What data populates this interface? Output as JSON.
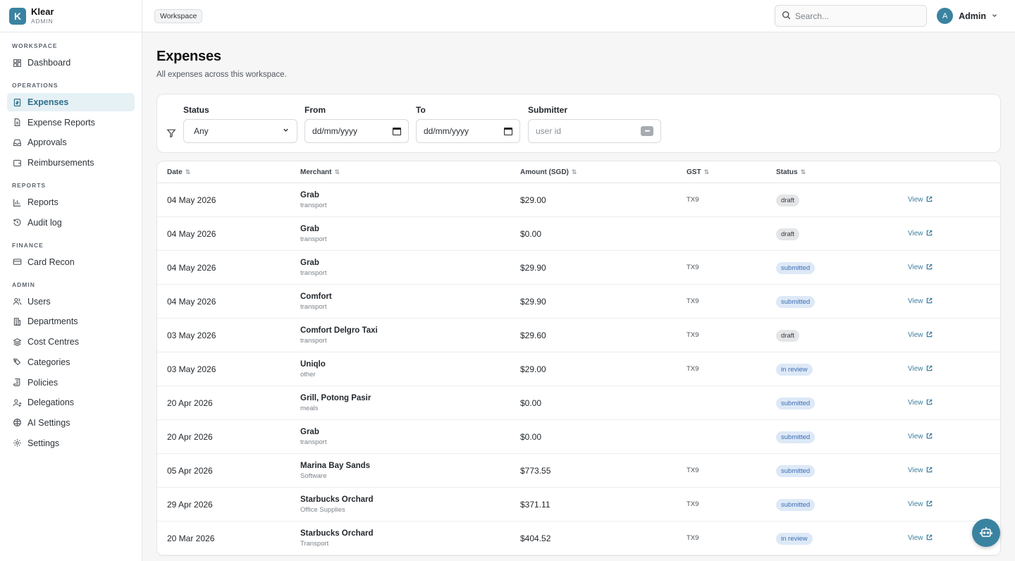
{
  "brand": {
    "initial": "K",
    "name": "Klear",
    "sub": "ADMIN"
  },
  "topbar": {
    "chip": "Workspace",
    "search_placeholder": "Search...",
    "user_initial": "A",
    "user_name": "Admin"
  },
  "sidebar": {
    "sections": [
      {
        "title": "WORKSPACE",
        "items": [
          {
            "label": "Dashboard",
            "icon": "dashboard-icon",
            "active": false
          }
        ]
      },
      {
        "title": "OPERATIONS",
        "items": [
          {
            "label": "Expenses",
            "icon": "expenses-icon",
            "active": true
          },
          {
            "label": "Expense Reports",
            "icon": "document-icon",
            "active": false
          },
          {
            "label": "Approvals",
            "icon": "inbox-icon",
            "active": false
          },
          {
            "label": "Reimbursements",
            "icon": "wallet-icon",
            "active": false
          }
        ]
      },
      {
        "title": "REPORTS",
        "items": [
          {
            "label": "Reports",
            "icon": "bar-chart-icon",
            "active": false
          },
          {
            "label": "Audit log",
            "icon": "history-icon",
            "active": false
          }
        ]
      },
      {
        "title": "FINANCE",
        "items": [
          {
            "label": "Card Recon",
            "icon": "credit-card-icon",
            "active": false
          }
        ]
      },
      {
        "title": "ADMIN",
        "items": [
          {
            "label": "Users",
            "icon": "users-icon",
            "active": false
          },
          {
            "label": "Departments",
            "icon": "building-icon",
            "active": false
          },
          {
            "label": "Cost Centres",
            "icon": "layers-icon",
            "active": false
          },
          {
            "label": "Categories",
            "icon": "tags-icon",
            "active": false
          },
          {
            "label": "Policies",
            "icon": "scroll-icon",
            "active": false
          },
          {
            "label": "Delegations",
            "icon": "user-switch-icon",
            "active": false
          },
          {
            "label": "AI Settings",
            "icon": "brain-icon",
            "active": false
          },
          {
            "label": "Settings",
            "icon": "gear-icon",
            "active": false
          }
        ]
      }
    ]
  },
  "page": {
    "title": "Expenses",
    "subtitle": "All expenses across this workspace."
  },
  "filters": {
    "status_label": "Status",
    "status_value": "Any",
    "from_label": "From",
    "from_value": "dd/mm/yyyy",
    "to_label": "To",
    "to_value": "dd/mm/yyyy",
    "submitter_label": "Submitter",
    "submitter_placeholder": "user id"
  },
  "table": {
    "headers": {
      "date": "Date",
      "merchant": "Merchant",
      "amount": "Amount (SGD)",
      "gst": "GST",
      "status": "Status"
    },
    "view_label": "View",
    "rows": [
      {
        "date": "04 May 2026",
        "merchant": "Grab",
        "category": "transport",
        "amount": "$29.00",
        "gst": "TX9",
        "status": "draft"
      },
      {
        "date": "04 May 2026",
        "merchant": "Grab",
        "category": "transport",
        "amount": "$0.00",
        "gst": "",
        "status": "draft"
      },
      {
        "date": "04 May 2026",
        "merchant": "Grab",
        "category": "transport",
        "amount": "$29.90",
        "gst": "TX9",
        "status": "submitted"
      },
      {
        "date": "04 May 2026",
        "merchant": "Comfort",
        "category": "transport",
        "amount": "$29.90",
        "gst": "TX9",
        "status": "submitted"
      },
      {
        "date": "03 May 2026",
        "merchant": "Comfort Delgro Taxi",
        "category": "transport",
        "amount": "$29.60",
        "gst": "TX9",
        "status": "draft"
      },
      {
        "date": "03 May 2026",
        "merchant": "Uniqlo",
        "category": "other",
        "amount": "$29.00",
        "gst": "TX9",
        "status": "in review"
      },
      {
        "date": "20 Apr 2026",
        "merchant": "Grill, Potong Pasir",
        "category": "meals",
        "amount": "$0.00",
        "gst": "",
        "status": "submitted"
      },
      {
        "date": "20 Apr 2026",
        "merchant": "Grab",
        "category": "transport",
        "amount": "$0.00",
        "gst": "",
        "status": "submitted"
      },
      {
        "date": "05 Apr 2026",
        "merchant": "Marina Bay Sands",
        "category": "Software",
        "amount": "$773.55",
        "gst": "TX9",
        "status": "submitted"
      },
      {
        "date": "29 Apr 2026",
        "merchant": "Starbucks Orchard",
        "category": "Office Supplies",
        "amount": "$371.11",
        "gst": "TX9",
        "status": "submitted"
      },
      {
        "date": "20 Mar 2026",
        "merchant": "Starbucks Orchard",
        "category": "Transport",
        "amount": "$404.52",
        "gst": "TX9",
        "status": "in review"
      }
    ]
  },
  "colors": {
    "accent": "#3a83a0",
    "active_bg": "#e6f1f5",
    "draft_bg": "#e4e5e7",
    "submitted_bg": "#dde9f7"
  }
}
